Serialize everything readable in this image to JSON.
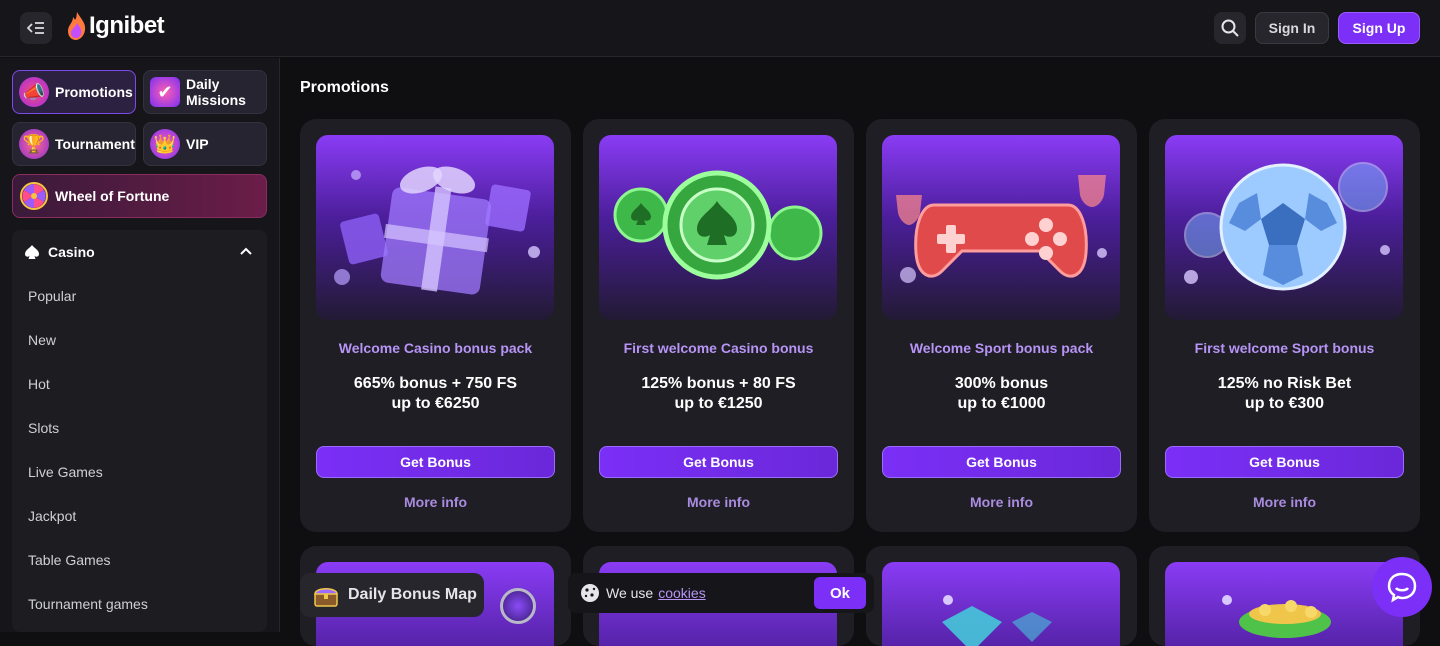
{
  "header": {
    "logo_text": "Ignibet",
    "signin_label": "Sign In",
    "signup_label": "Sign Up"
  },
  "sidebar": {
    "pills": [
      {
        "label": "Promotions"
      },
      {
        "label": "Daily Missions"
      },
      {
        "label": "Tournament"
      },
      {
        "label": "VIP"
      },
      {
        "label": "Wheel of Fortune"
      }
    ],
    "casino_label": "Casino",
    "categories": [
      "Popular",
      "New",
      "Hot",
      "Slots",
      "Live Games",
      "Jackpot",
      "Table Games",
      "Tournament games"
    ]
  },
  "main": {
    "title": "Promotions",
    "cards": [
      {
        "title": "Welcome Casino bonus pack",
        "offer_line1": "665% bonus + 750 FS",
        "offer_line2": "up to €6250",
        "button": "Get Bonus",
        "more": "More info"
      },
      {
        "title": "First welcome Casino bonus",
        "offer_line1": "125% bonus + 80 FS",
        "offer_line2": "up to €1250",
        "button": "Get Bonus",
        "more": "More info"
      },
      {
        "title": "Welcome Sport bonus pack",
        "offer_line1": "300% bonus",
        "offer_line2": "up to €1000",
        "button": "Get Bonus",
        "more": "More info"
      },
      {
        "title": "First welcome Sport bonus",
        "offer_line1": "125% no Risk Bet",
        "offer_line2": "up to €300",
        "button": "Get Bonus",
        "more": "More info"
      }
    ]
  },
  "daily_bonus_map": {
    "label": "Daily Bonus Map"
  },
  "cookie_banner": {
    "text": "We use",
    "link": "cookies",
    "ok": "Ok"
  },
  "colors": {
    "accent": "#7b2ff7",
    "card_title": "#b794f6"
  }
}
